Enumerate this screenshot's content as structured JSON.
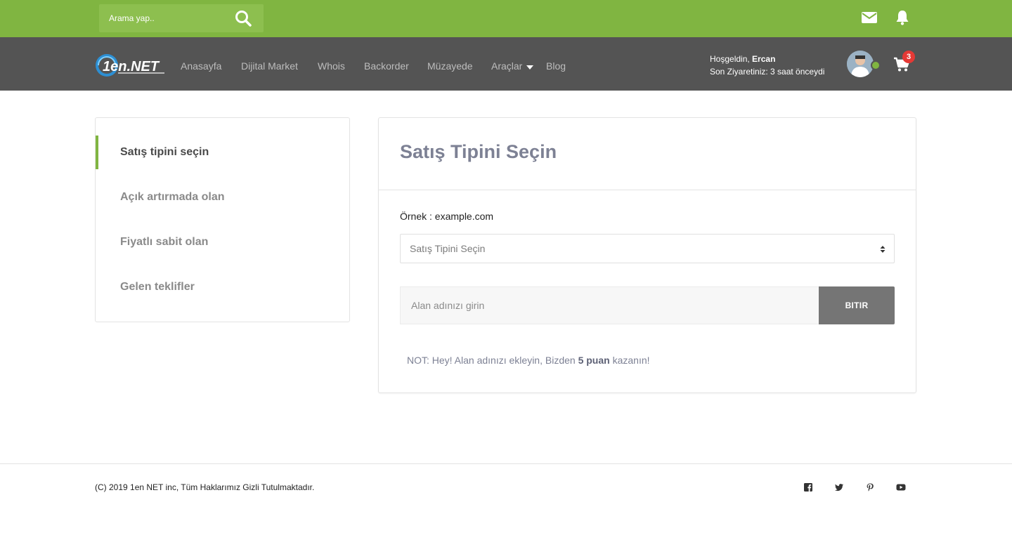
{
  "topbar": {
    "search_placeholder": "Arama yap..",
    "icons": [
      "search-icon",
      "envelope-icon",
      "bell-icon"
    ],
    "color": "#80b541"
  },
  "navbar": {
    "logo_alt": "1en.NET",
    "links": [
      "Anasayfa",
      "Dijital Market",
      "Whois",
      "Backorder",
      "Müzayede",
      "Araçlar",
      "Blog"
    ],
    "welcome_prefix": "Hoşgeldin, ",
    "user_name": "Ercan",
    "last_visit": "Son Ziyaretiniz: 3 saat önceydi",
    "cart_count": "3",
    "color": "#545454"
  },
  "sidebar": {
    "items": [
      {
        "label": "Satış tipini seçin",
        "active": true
      },
      {
        "label": "Açık artırmada olan",
        "active": false
      },
      {
        "label": "Fiyatlı sabit olan",
        "active": false
      },
      {
        "label": "Gelen teklifler",
        "active": false
      }
    ]
  },
  "main": {
    "title": "Satış Tipini Seçin",
    "example_label": "Örnek : example.com",
    "select_value": "Satış Tipini Seçin",
    "domain_placeholder": "Alan adınızı girin",
    "submit_label": "BITIR",
    "note_prefix": "NOT: Hey! Alan adınızı ekleyin, Bizden ",
    "note_bold": "5 puan",
    "note_suffix": " kazanın!"
  },
  "footer": {
    "copyright": "(C) 2019 1en NET inc, Tüm Haklarımız Gizli Tutulmaktadır.",
    "social_icons": [
      "facebook-icon",
      "twitter-icon",
      "pinterest-icon",
      "youtube-icon"
    ]
  }
}
